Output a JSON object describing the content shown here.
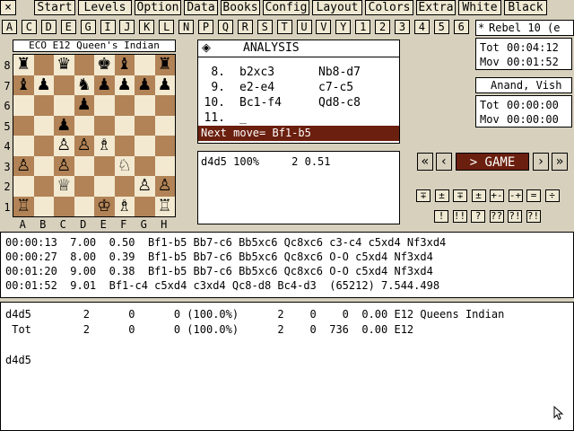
{
  "menubar": {
    "close": "×",
    "items": [
      "Start",
      "Levels",
      "Option",
      "Data",
      "Books",
      "Config",
      "Layout",
      "Colors",
      "Extra",
      "White",
      "Black"
    ]
  },
  "letters": [
    "A",
    "C",
    "D",
    "E",
    "G",
    "I",
    "J",
    "K",
    "L",
    "N",
    "P",
    "Q",
    "R",
    "S",
    "T",
    "U",
    "V",
    "Y",
    "1",
    "2",
    "3",
    "4",
    "5",
    "6"
  ],
  "engine": {
    "star": "*",
    "name": "Rebel 10 (e"
  },
  "clock_top": {
    "tot_label": "Tot",
    "tot_value": "00:04:12",
    "mov_label": "Mov",
    "mov_value": "00:01:52"
  },
  "player": {
    "name": "Anand, Vish"
  },
  "clock_bottom": {
    "tot_label": "Tot",
    "tot_value": "00:00:00",
    "mov_label": "Mov",
    "mov_value": "00:00:00"
  },
  "board_title": "ECO E12 Queen's Indian",
  "ranks": [
    "8",
    "7",
    "6",
    "5",
    "4",
    "3",
    "2",
    "1"
  ],
  "files": [
    "A",
    "B",
    "C",
    "D",
    "E",
    "F",
    "G",
    "H"
  ],
  "pieces": {
    "rank8": [
      "♜",
      "",
      "♛",
      "",
      "♚",
      "♝",
      "",
      "♜"
    ],
    "rank7": [
      "♝",
      "♟",
      "",
      "♞",
      "♟",
      "♟",
      "♟",
      "♟"
    ],
    "rank6": [
      "",
      "",
      "",
      "♟",
      "",
      "",
      "",
      ""
    ],
    "rank5": [
      "",
      "",
      "♟",
      "",
      "",
      "",
      "",
      ""
    ],
    "rank4": [
      "",
      "",
      "♙",
      "♙",
      "♗",
      "",
      "",
      ""
    ],
    "rank3": [
      "♙",
      "",
      "♙",
      "",
      "",
      "♘",
      "",
      ""
    ],
    "rank2": [
      "",
      "",
      "♕",
      "",
      "",
      "",
      "♙",
      "♙"
    ],
    "rank1": [
      "♖",
      "",
      "",
      "",
      "♔",
      "♗",
      "",
      "♖"
    ]
  },
  "analysis": {
    "icon": "clock-icon",
    "title": "ANALYSIS",
    "moves": [
      {
        "num": "8.",
        "white": "b2xc3",
        "black": "Nb8-d7"
      },
      {
        "num": "9.",
        "white": "e2-e4",
        "black": "c7-c5"
      },
      {
        "num": "10.",
        "white": "Bc1-f4",
        "black": "Qd8-c8"
      },
      {
        "num": "11.",
        "white": "_",
        "black": ""
      }
    ],
    "next_move": "Next move= Bf1-b5"
  },
  "book_line": "d4d5 100%     2 0.51",
  "nav": {
    "first": "«",
    "prev": "‹",
    "game": "> GAME",
    "next": "›",
    "last": "»"
  },
  "annotations": {
    "row1": [
      "∓",
      "±",
      "∓",
      "±",
      "+-",
      "-+",
      "=",
      "÷"
    ],
    "row2": [
      "!",
      "!!",
      "?",
      "??",
      "?!",
      "?!"
    ]
  },
  "pv_lines": [
    "00:00:13  7.00  0.50  Bf1-b5 Bb7-c6 Bb5xc6 Qc8xc6 c3-c4 c5xd4 Nf3xd4",
    "00:00:27  8.00  0.39  Bf1-b5 Bb7-c6 Bb5xc6 Qc8xc6 O-O c5xd4 Nf3xd4",
    "00:01:20  9.00  0.38  Bf1-b5 Bb7-c6 Bb5xc6 Qc8xc6 O-O c5xd4 Nf3xd4",
    "00:01:52  9.01  Bf1-c4 c5xd4 c3xd4 Qc8-d8 Bc4-d3  (65212) 7.544.498"
  ],
  "stats_lines": [
    "d4d5        2      0      0 (100.0%)      2    0    0  0.00 E12 Queens Indian",
    " Tot        2      0      0 (100.0%)      2    0  736  0.00 E12",
    "",
    "d4d5"
  ]
}
